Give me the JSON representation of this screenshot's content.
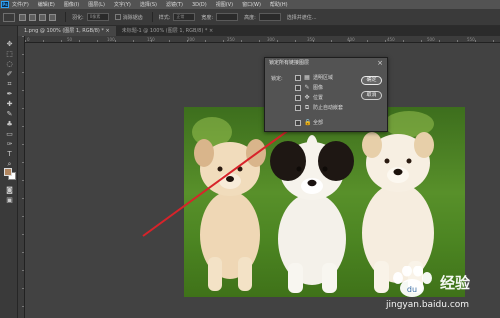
{
  "app": {
    "logo": "Ps"
  },
  "menubar": {
    "items": [
      "文件(F)",
      "编辑(E)",
      "图像(I)",
      "图层(L)",
      "文字(Y)",
      "选择(S)",
      "滤镜(T)",
      "3D(D)",
      "视图(V)",
      "窗口(W)",
      "帮助(H)"
    ]
  },
  "options": {
    "feather_label": "羽化:",
    "feather_value": "0像素",
    "antialias_label": "消除锯齿",
    "style_label": "样式:",
    "style_value": "正常",
    "width_label": "宽度:",
    "height_label": "高度:",
    "select_mask_label": "选择并遮住..."
  },
  "tabs": [
    {
      "label": "1.png @ 100% (图层 1, RGB/8) *",
      "close": "×"
    },
    {
      "label": "未标题-1 @ 100% (图层 1, RGB/8) *",
      "close": "×"
    }
  ],
  "rulers": {
    "top": [
      "0",
      "50",
      "100",
      "150",
      "200",
      "250",
      "300",
      "350",
      "400",
      "450",
      "500",
      "550"
    ]
  },
  "dialog": {
    "title": "锁定所有链接图层",
    "close": "×",
    "lock_label": "锁定:",
    "options": [
      {
        "label": "透明区域",
        "icon": "▦"
      },
      {
        "label": "图像",
        "icon": "✎"
      },
      {
        "label": "位置",
        "icon": "✥"
      },
      {
        "label": "防止自动嵌套",
        "icon": "⧉"
      },
      {
        "label": "全部",
        "icon": "🔒"
      }
    ],
    "ok_label": "确定",
    "cancel_label": "取消"
  },
  "watermark": {
    "brand": "经验",
    "url": "jingyan.baidu.com"
  },
  "colors": {
    "annotation_arrow": "#d8232a",
    "ui_dark": "#3a3a3a",
    "ui_panel": "#535353"
  }
}
